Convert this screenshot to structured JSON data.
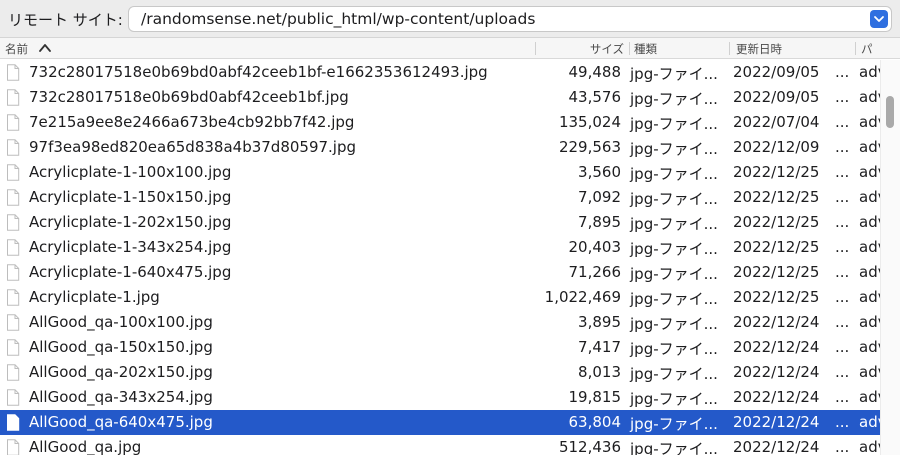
{
  "sitebar": {
    "label": "リモート サイト:",
    "path": "/randomsense.net/public_html/wp-content/uploads"
  },
  "columns": {
    "name": "名前",
    "size": "サイズ",
    "type": "種類",
    "modified": "更新日時",
    "permissions": "パ"
  },
  "files": [
    {
      "name": "732c28017518e0b69bd0abf42ceeb1bf-e1662353612493.jpg",
      "size": "49,488",
      "type": "jpg-ファイ...",
      "date": "2022/09/05",
      "dots": "...",
      "perm": "adv"
    },
    {
      "name": "732c28017518e0b69bd0abf42ceeb1bf.jpg",
      "size": "43,576",
      "type": "jpg-ファイ...",
      "date": "2022/09/05",
      "dots": "...",
      "perm": "adv"
    },
    {
      "name": "7e215a9ee8e2466a673be4cb92bb7f42.jpg",
      "size": "135,024",
      "type": "jpg-ファイ...",
      "date": "2022/07/04",
      "dots": "...",
      "perm": "adv"
    },
    {
      "name": "97f3ea98ed820ea65d838a4b37d80597.jpg",
      "size": "229,563",
      "type": "jpg-ファイ...",
      "date": "2022/12/09",
      "dots": "...",
      "perm": "adv"
    },
    {
      "name": "Acrylicplate-1-100x100.jpg",
      "size": "3,560",
      "type": "jpg-ファイ...",
      "date": "2022/12/25",
      "dots": "...",
      "perm": "adv"
    },
    {
      "name": "Acrylicplate-1-150x150.jpg",
      "size": "7,092",
      "type": "jpg-ファイ...",
      "date": "2022/12/25",
      "dots": "...",
      "perm": "adv"
    },
    {
      "name": "Acrylicplate-1-202x150.jpg",
      "size": "7,895",
      "type": "jpg-ファイ...",
      "date": "2022/12/25",
      "dots": "...",
      "perm": "adv"
    },
    {
      "name": "Acrylicplate-1-343x254.jpg",
      "size": "20,403",
      "type": "jpg-ファイ...",
      "date": "2022/12/25",
      "dots": "...",
      "perm": "adv"
    },
    {
      "name": "Acrylicplate-1-640x475.jpg",
      "size": "71,266",
      "type": "jpg-ファイ...",
      "date": "2022/12/25",
      "dots": "...",
      "perm": "adv"
    },
    {
      "name": "Acrylicplate-1.jpg",
      "size": "1,022,469",
      "type": "jpg-ファイ...",
      "date": "2022/12/25",
      "dots": "...",
      "perm": "adv"
    },
    {
      "name": "AllGood_qa-100x100.jpg",
      "size": "3,895",
      "type": "jpg-ファイ...",
      "date": "2022/12/24",
      "dots": "...",
      "perm": "adv"
    },
    {
      "name": "AllGood_qa-150x150.jpg",
      "size": "7,417",
      "type": "jpg-ファイ...",
      "date": "2022/12/24",
      "dots": "...",
      "perm": "adv"
    },
    {
      "name": "AllGood_qa-202x150.jpg",
      "size": "8,013",
      "type": "jpg-ファイ...",
      "date": "2022/12/24",
      "dots": "...",
      "perm": "adv"
    },
    {
      "name": "AllGood_qa-343x254.jpg",
      "size": "19,815",
      "type": "jpg-ファイ...",
      "date": "2022/12/24",
      "dots": "...",
      "perm": "adv"
    },
    {
      "name": "AllGood_qa-640x475.jpg",
      "size": "63,804",
      "type": "jpg-ファイ...",
      "date": "2022/12/24",
      "dots": "...",
      "perm": "adv",
      "selected": true
    },
    {
      "name": "AllGood_qa.jpg",
      "size": "512,436",
      "type": "jpg-ファイ...",
      "date": "2022/12/24",
      "dots": "...",
      "perm": "adv"
    }
  ],
  "scrollbar": {
    "thumb_start_fraction": 0.09,
    "thumb_length_fraction": 0.08
  },
  "colors": {
    "selection": "#2459c9",
    "accent": "#2f6fe0"
  },
  "icons": {
    "file": "file-icon",
    "sort": "sort-ascending-icon",
    "dropdown": "chevron-down-icon"
  }
}
